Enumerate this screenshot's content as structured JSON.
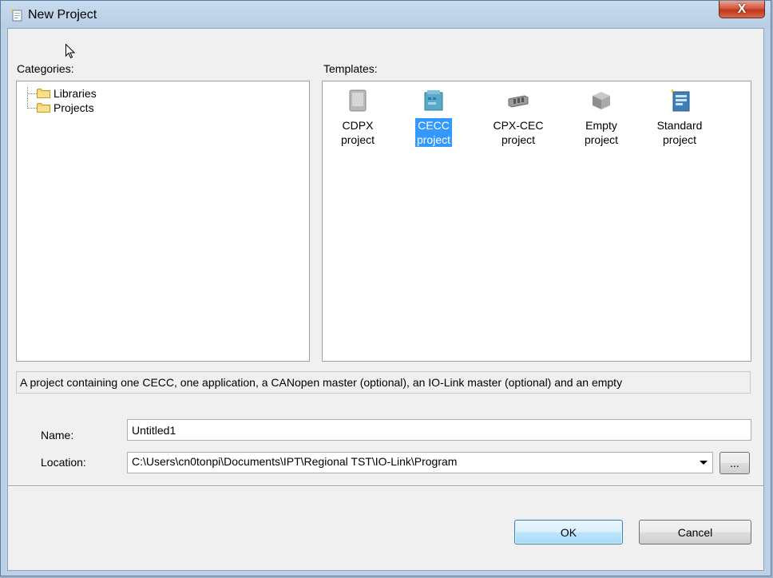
{
  "window": {
    "title": "New Project",
    "close_label": "X"
  },
  "categories": {
    "label": "Categories:",
    "items": [
      {
        "label": "Libraries"
      },
      {
        "label": "Projects"
      }
    ]
  },
  "templates": {
    "label": "Templates:",
    "items": [
      {
        "line1": "CDPX",
        "line2": "project",
        "icon": "cdpx-device-icon",
        "selected": false
      },
      {
        "line1": "CECC",
        "line2": "project",
        "icon": "cecc-controller-icon",
        "selected": true
      },
      {
        "line1": "CPX-CEC",
        "line2": "project",
        "icon": "cpx-cec-module-icon",
        "selected": false
      },
      {
        "line1": "Empty",
        "line2": "project",
        "icon": "empty-cube-icon",
        "selected": false
      },
      {
        "line1": "Standard",
        "line2": "project",
        "icon": "standard-project-icon",
        "selected": false
      }
    ]
  },
  "description": "A project containing one CECC, one application, a CANopen master (optional), an IO-Link master (optional) and an empty",
  "form": {
    "name_label": "Name:",
    "name_value": "Untitled1",
    "location_label": "Location:",
    "location_value": "C:\\Users\\cn0tonpi\\Documents\\IPT\\Regional TST\\IO-Link\\Program",
    "browse_label": "..."
  },
  "buttons": {
    "ok": "OK",
    "cancel": "Cancel"
  }
}
